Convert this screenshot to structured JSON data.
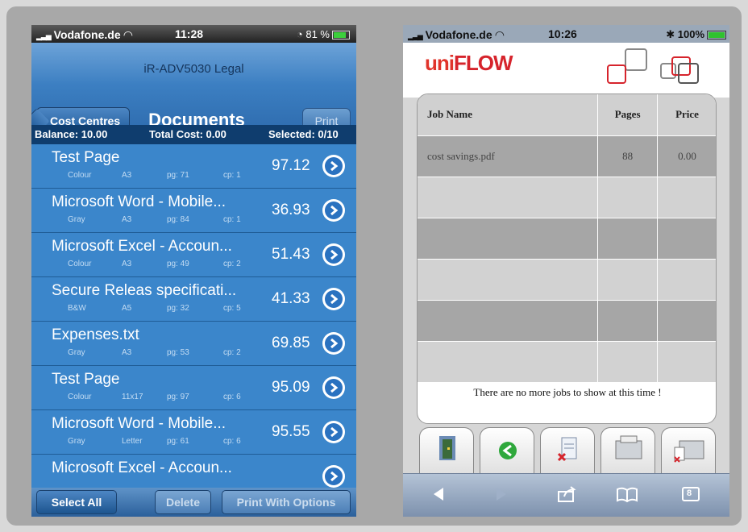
{
  "phone1": {
    "status": {
      "carrier": "Vodafone.de",
      "time": "11:28",
      "battery": "81 %"
    },
    "subtitle": "iR-ADV5030 Legal",
    "back_label": "Cost Centres",
    "title": "Documents",
    "print_label": "Print",
    "summary": {
      "balance": "Balance: 10.00",
      "total": "Total Cost: 0.00",
      "selected": "Selected: 0/10"
    },
    "documents": [
      {
        "name": "Test Page",
        "color": "Colour",
        "size": "A3",
        "pages": "pg: 71",
        "copies": "cp: 1",
        "cost": "97.12"
      },
      {
        "name": "Microsoft Word - Mobile...",
        "color": "Gray",
        "size": "A3",
        "pages": "pg: 84",
        "copies": "cp: 1",
        "cost": "36.93"
      },
      {
        "name": "Microsoft Excel - Accoun...",
        "color": "Colour",
        "size": "A3",
        "pages": "pg: 49",
        "copies": "cp: 2",
        "cost": "51.43"
      },
      {
        "name": "Secure Releas specificati...",
        "color": "B&W",
        "size": "A5",
        "pages": "pg: 32",
        "copies": "cp: 5",
        "cost": "41.33"
      },
      {
        "name": "Expenses.txt",
        "color": "Gray",
        "size": "A3",
        "pages": "pg: 53",
        "copies": "cp: 2",
        "cost": "69.85"
      },
      {
        "name": "Test Page",
        "color": "Colour",
        "size": "11x17",
        "pages": "pg: 97",
        "copies": "cp: 6",
        "cost": "95.09"
      },
      {
        "name": "Microsoft Word - Mobile...",
        "color": "Gray",
        "size": "Letter",
        "pages": "pg: 61",
        "copies": "cp: 6",
        "cost": "95.55"
      },
      {
        "name": "Microsoft Excel - Accoun...",
        "color": "",
        "size": "",
        "pages": "",
        "copies": "",
        "cost": ""
      }
    ],
    "toolbar": {
      "select_all": "Select All",
      "delete": "Delete",
      "print_with_options": "Print With Options"
    }
  },
  "phone2": {
    "status": {
      "carrier": "Vodafone.de",
      "time": "10:26",
      "battery": "100%"
    },
    "logo": {
      "uni": "uni",
      "flow": "FLOW"
    },
    "table": {
      "headers": [
        "Job Name",
        "Pages",
        "Price"
      ],
      "rows": [
        {
          "name": "cost savings.pdf",
          "pages": "88",
          "price": "0.00"
        }
      ]
    },
    "footer_message": "There are no more jobs to show at this time !",
    "tabs_badge": "8"
  },
  "colors": {
    "ios_blue": "#3b86cb",
    "dark_blue": "#0f3d6e",
    "uniflow_red": "#d6242c"
  }
}
